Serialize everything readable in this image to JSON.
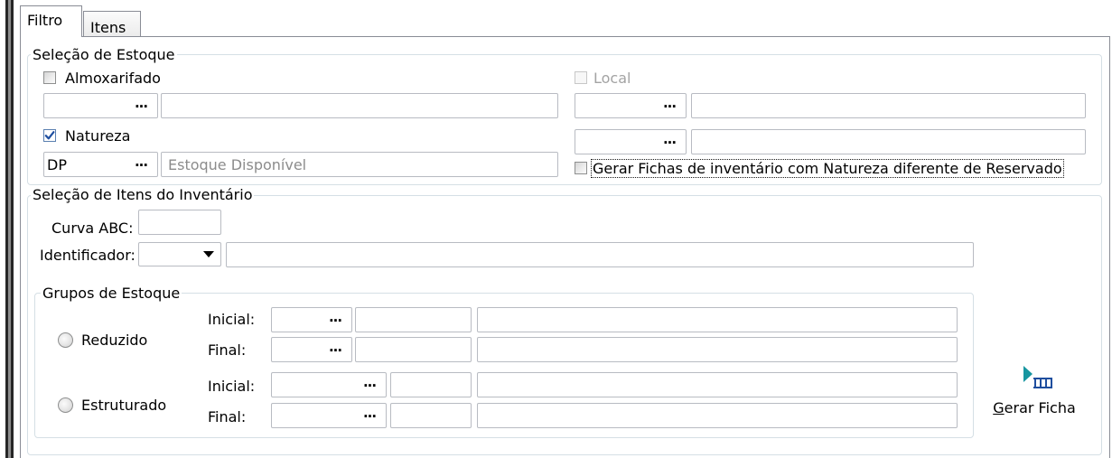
{
  "tabs": [
    {
      "label": "Filtro",
      "active": true
    },
    {
      "label": "Itens",
      "active": false
    }
  ],
  "lookup_button": "...",
  "estoque": {
    "title": "Seleção de Estoque",
    "almoxarifado": {
      "label": "Almoxarifado",
      "checked": false,
      "code": "",
      "description": ""
    },
    "local": {
      "label": "Local",
      "checked": false,
      "enabled": false,
      "row1": {
        "code": "",
        "description": ""
      },
      "row2": {
        "code": "",
        "description": ""
      }
    },
    "natureza": {
      "label": "Natureza",
      "checked": true,
      "code": "DP",
      "description": "Estoque Disponível"
    },
    "gerar_fichas_reservado": {
      "label": "Gerar Fichas de inventário com Natureza diferente de Reservado",
      "checked": false
    }
  },
  "itens": {
    "title": "Seleção de Itens do Inventário",
    "curva_abc": {
      "label": "Curva ABC:",
      "value": ""
    },
    "identificador": {
      "label": "Identificador:",
      "selected": "",
      "text": ""
    },
    "grupos": {
      "title": "Grupos de Estoque",
      "reduzido": {
        "label": "Reduzido",
        "selected": false,
        "inicial": {
          "label": "Inicial:",
          "code": "",
          "value": "",
          "description": ""
        },
        "final": {
          "label": "Final:",
          "code": "",
          "value": "",
          "description": ""
        }
      },
      "estruturado": {
        "label": "Estruturado",
        "selected": false,
        "inicial": {
          "label": "Inicial:",
          "code": "",
          "value": "",
          "description": ""
        },
        "final": {
          "label": "Final:",
          "code": "",
          "value": "",
          "description": ""
        }
      }
    }
  },
  "actions": {
    "gerar_ficha": {
      "label": "Gerar Ficha",
      "icon": "generate-sheet-icon"
    }
  },
  "icons": {
    "dropdown": "chevron-down-icon",
    "check": "checkmark-icon"
  },
  "colors": {
    "check_mark": "#1f4fa0",
    "icon_teal": "#1796a0",
    "icon_blue": "#1f4e9e",
    "disabled_text": "#a3a3a3"
  }
}
